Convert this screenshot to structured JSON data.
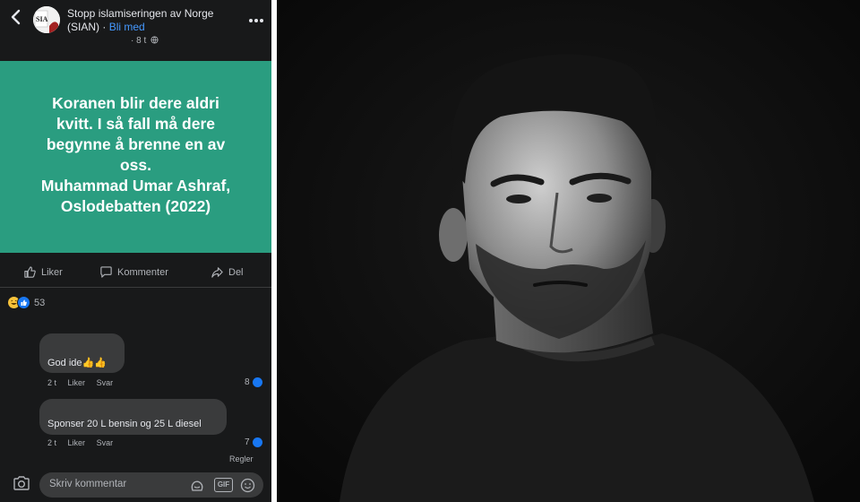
{
  "post_header": {
    "group_name": "Stopp islamiseringen av Norge (SIAN)",
    "separator": "·",
    "join_label": "Bli med",
    "timestamp": "8 t",
    "avatar_text": "SIAN"
  },
  "post": {
    "background_color": "#2a9d80",
    "quote_lines": [
      "Koranen blir dere aldri",
      "kvitt. I så fall må dere",
      "begynne å brenne en av",
      "oss.",
      "Muhammad Umar Ashraf,",
      "Oslodebatten (2022)"
    ]
  },
  "actions": {
    "like_label": "Liker",
    "comment_label": "Kommenter",
    "share_label": "Del"
  },
  "reactions": {
    "count": "53",
    "icons": [
      "haha-icon",
      "like-icon"
    ]
  },
  "comments": [
    {
      "text": "God ide👍👍",
      "time": "2 t",
      "like_label": "Liker",
      "reply_label": "Svar",
      "like_count": "8"
    },
    {
      "text": "Sponser 20 L bensin og 25 L diesel",
      "time": "2 t",
      "like_label": "Liker",
      "reply_label": "Svar",
      "like_count": "7"
    }
  ],
  "rules_label": "Regler",
  "composer": {
    "placeholder": "Skriv kommentar",
    "gif_label": "GIF"
  },
  "colors": {
    "fb_background": "#18191a",
    "link_blue": "#4599ff",
    "like_blue": "#1877f2"
  }
}
